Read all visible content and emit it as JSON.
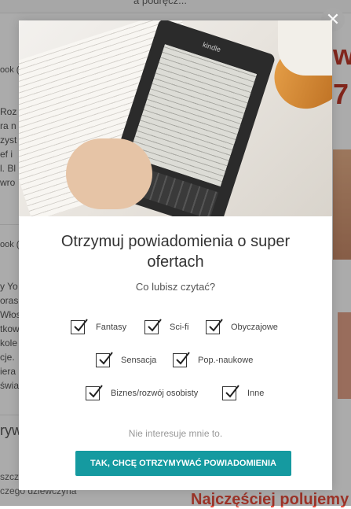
{
  "background": {
    "topbar_text": "a podręcz...",
    "side_texts": [
      "ook (",
      "Roz",
      "ra n",
      "zyst",
      "ef i",
      "l. Bl",
      "wro",
      "ook (",
      "y Yo",
      "oras",
      "Włos",
      "tkow",
      "kole",
      "cje.",
      "iera",
      "świa"
    ],
    "right_big": "w",
    "right_big2": "7",
    "bottom_title": "ryw",
    "bottom_left": "szczę... wiają go... haja wszystko, czego dziewczyna",
    "bottom_right": "Najczęściej polujemy"
  },
  "modal": {
    "close_icon": "close-icon",
    "hero": {
      "brand": "kindle"
    },
    "title": "Otrzymuj powiadomienia o super ofertach",
    "subtitle": "Co lubisz czytać?",
    "options": [
      {
        "label": "Fantasy",
        "checked": true
      },
      {
        "label": "Sci-fi",
        "checked": true
      },
      {
        "label": "Obyczajowe",
        "checked": true
      },
      {
        "label": "Sensacja",
        "checked": true
      },
      {
        "label": "Pop.-naukowe",
        "checked": true
      },
      {
        "label": "Biznes/rozwój osobisty",
        "checked": true
      },
      {
        "label": "Inne",
        "checked": true
      }
    ],
    "decline_text": "Nie interesuje mnie to.",
    "cta_label": "TAK, CHCĘ OTRZYMYWAĆ POWIADOMIENIA"
  },
  "colors": {
    "accent": "#159aa0",
    "overlay": "rgba(0,0,0,0.33)"
  }
}
